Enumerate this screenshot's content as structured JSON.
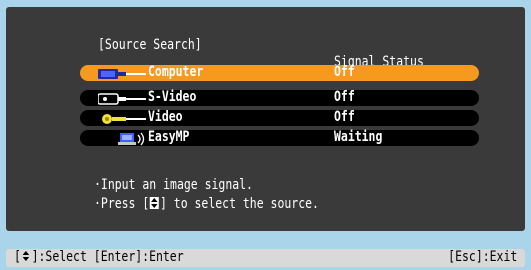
{
  "dialog": {
    "title": "[Source Search]",
    "column_header": "Signal Status"
  },
  "sources": [
    {
      "name": "Computer",
      "status": "Off",
      "icon": "computer-icon",
      "selected": true
    },
    {
      "name": "S-Video",
      "status": "Off",
      "icon": "s-video-icon",
      "selected": false
    },
    {
      "name": "Video",
      "status": "Off",
      "icon": "video-icon",
      "selected": false
    },
    {
      "name": "EasyMP",
      "status": "Waiting",
      "icon": "easymp-icon",
      "selected": false
    }
  ],
  "messages": {
    "line1": "·Input an image signal.",
    "line2_prefix": "·Press [",
    "line2_suffix": "] to select the source."
  },
  "footer": {
    "left_prefix": "[",
    "left_suffix": "]:Select [Enter]:Enter",
    "right": "[Esc]:Exit"
  },
  "colors": {
    "background": "#a9d4ea",
    "panel": "#3a3a3a",
    "highlight": "#f59a1e",
    "footer": "#d9d9d9"
  }
}
